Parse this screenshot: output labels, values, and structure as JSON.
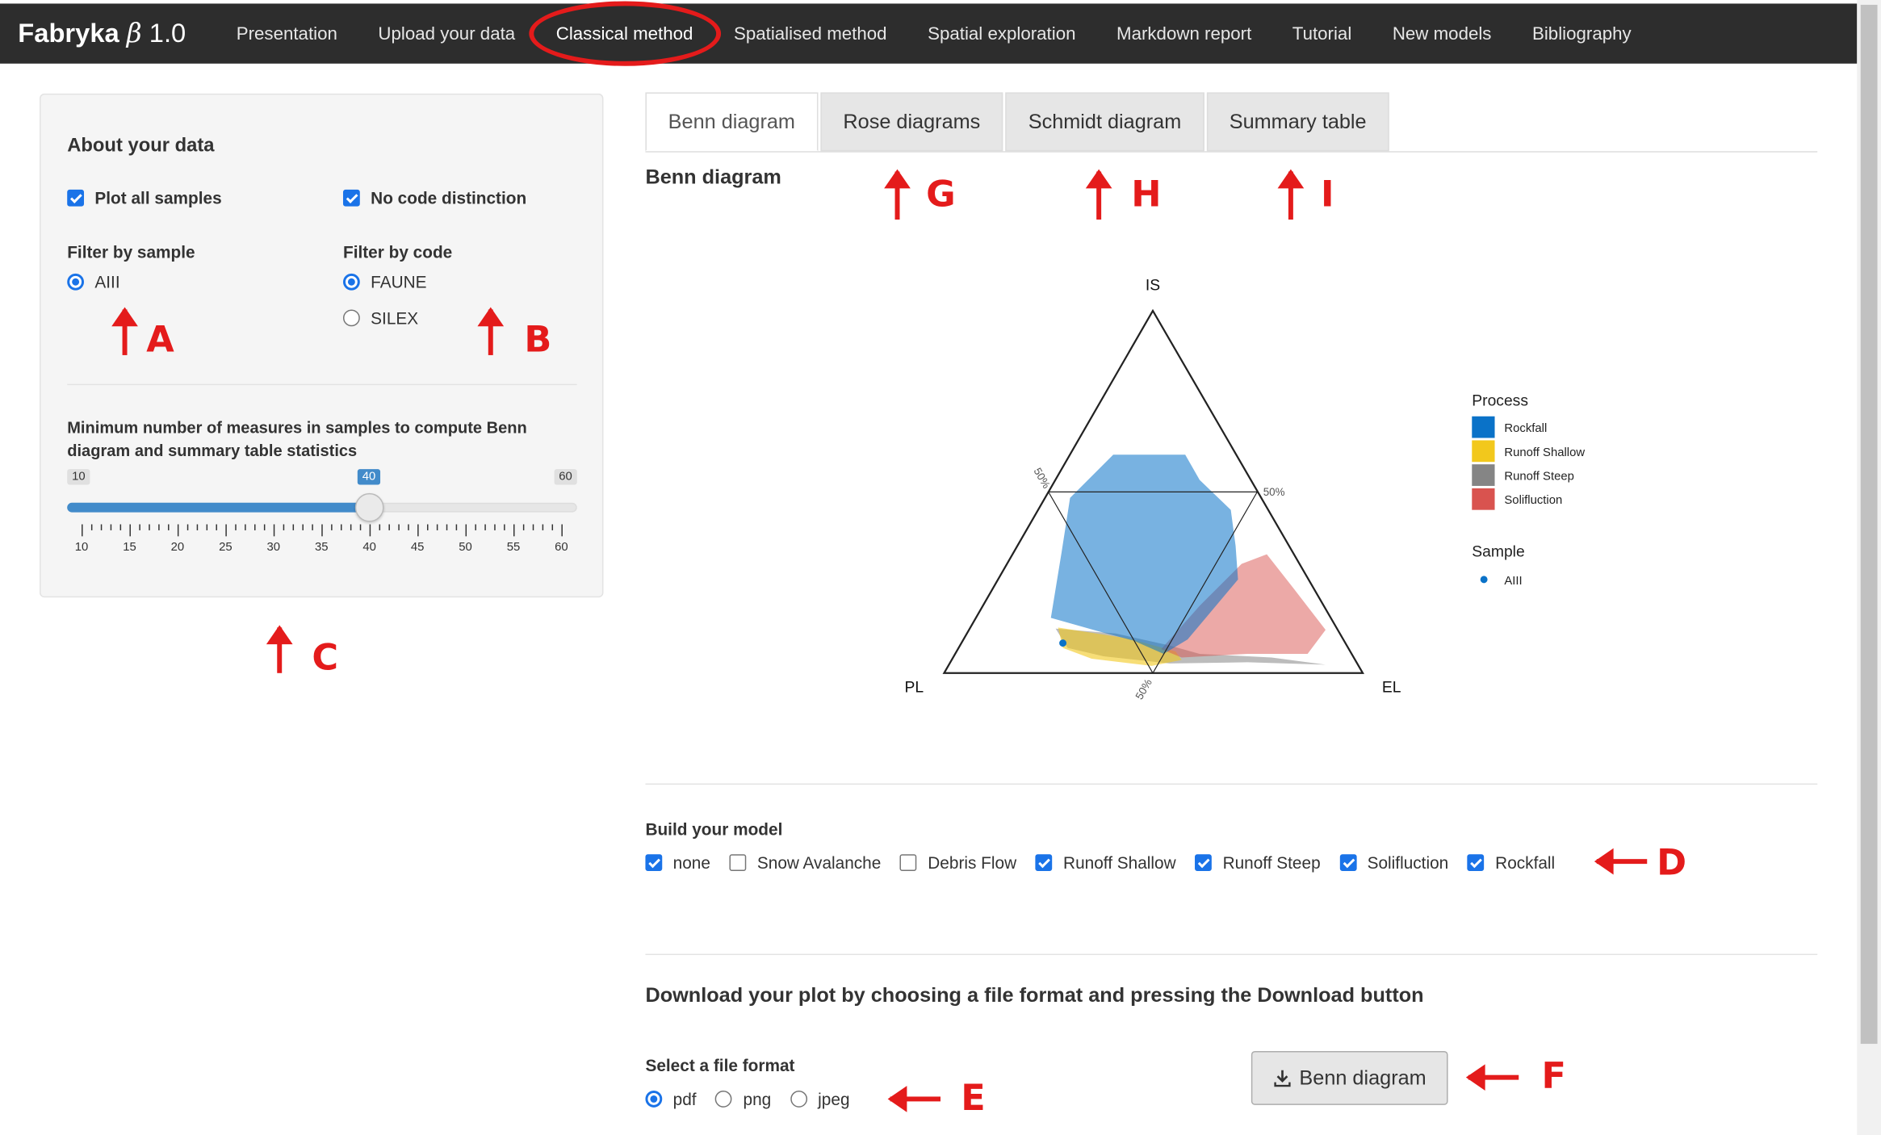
{
  "app": {
    "brand_name": "Fabryka",
    "brand_symbol": "β",
    "brand_version": "1.0"
  },
  "nav": {
    "items": [
      {
        "label": "Presentation"
      },
      {
        "label": "Upload your data"
      },
      {
        "label": "Classical method",
        "active": true
      },
      {
        "label": "Spatialised method"
      },
      {
        "label": "Spatial exploration"
      },
      {
        "label": "Markdown report"
      },
      {
        "label": "Tutorial"
      },
      {
        "label": "New models"
      },
      {
        "label": "Bibliography"
      }
    ]
  },
  "sidebar": {
    "title": "About your data",
    "plot_all_samples": {
      "label": "Plot all samples",
      "checked": true
    },
    "no_code_distinction": {
      "label": "No code distinction",
      "checked": true
    },
    "filter_sample": {
      "label": "Filter by sample",
      "options": [
        {
          "label": "AIII",
          "selected": true
        }
      ]
    },
    "filter_code": {
      "label": "Filter by code",
      "options": [
        {
          "label": "FAUNE",
          "selected": true
        },
        {
          "label": "SILEX",
          "selected": false
        }
      ]
    },
    "slider": {
      "label": "Minimum number of measures in samples to compute Benn diagram and summary table statistics",
      "min": "10",
      "max": "60",
      "value": "40",
      "tick_labels": [
        "10",
        "15",
        "20",
        "25",
        "30",
        "35",
        "40",
        "45",
        "50",
        "55",
        "60"
      ]
    }
  },
  "tabs": [
    {
      "label": "Benn diagram",
      "active": true
    },
    {
      "label": "Rose diagrams"
    },
    {
      "label": "Schmidt diagram"
    },
    {
      "label": "Summary table"
    }
  ],
  "main": {
    "benn_title": "Benn diagram"
  },
  "chart_data": {
    "type": "ternary",
    "vertices": {
      "top": "IS",
      "left": "PL",
      "right": "EL"
    },
    "midline_labels": [
      "50%",
      "50%",
      "50%"
    ],
    "legend": {
      "process_title": "Process",
      "processes": [
        {
          "name": "Rockfall",
          "color": "#0a72c8"
        },
        {
          "name": "Runoff Shallow",
          "color": "#f2c81c"
        },
        {
          "name": "Runoff Steep",
          "color": "#858585"
        },
        {
          "name": "Solifluction",
          "color": "#d9534f"
        }
      ],
      "sample_title": "Sample",
      "samples": [
        {
          "name": "AIII",
          "color": "#0a72c8"
        }
      ]
    }
  },
  "model": {
    "label": "Build your model",
    "items": [
      {
        "label": "none",
        "checked": true
      },
      {
        "label": "Snow Avalanche",
        "checked": false
      },
      {
        "label": "Debris Flow",
        "checked": false
      },
      {
        "label": "Runoff Shallow",
        "checked": true
      },
      {
        "label": "Runoff Steep",
        "checked": true
      },
      {
        "label": "Solifluction",
        "checked": true
      },
      {
        "label": "Rockfall",
        "checked": true
      }
    ]
  },
  "download": {
    "title": "Download your plot by choosing a file format and pressing the Download button",
    "format_label": "Select a file format",
    "formats": [
      {
        "label": "pdf",
        "selected": true
      },
      {
        "label": "png",
        "selected": false
      },
      {
        "label": "jpeg",
        "selected": false
      }
    ],
    "button_label": "Benn diagram"
  },
  "annotations": {
    "A": "A",
    "B": "B",
    "C": "C",
    "D": "D",
    "E": "E",
    "F": "F",
    "G": "G",
    "H": "H",
    "I": "I"
  },
  "colors": {
    "navbar": "#2d2d2d",
    "accent": "#1a73e8",
    "annotation": "#e41b1b"
  }
}
